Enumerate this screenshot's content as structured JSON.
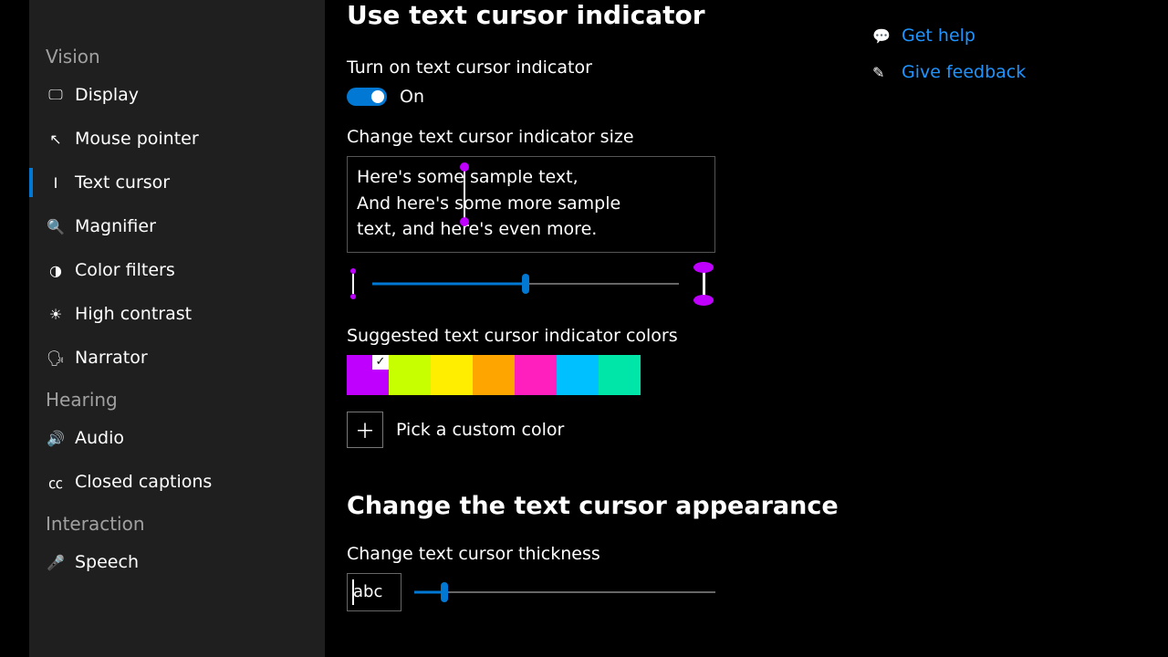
{
  "sidebar": {
    "sections": [
      {
        "title": "Vision",
        "items": [
          {
            "icon": "display-icon",
            "label": "Display"
          },
          {
            "icon": "pointer-icon",
            "label": "Mouse pointer"
          },
          {
            "icon": "textcursor-icon",
            "label": "Text cursor",
            "active": true
          },
          {
            "icon": "magnifier-icon",
            "label": "Magnifier"
          },
          {
            "icon": "filters-icon",
            "label": "Color filters"
          },
          {
            "icon": "contrast-icon",
            "label": "High contrast"
          },
          {
            "icon": "narrator-icon",
            "label": "Narrator"
          }
        ]
      },
      {
        "title": "Hearing",
        "items": [
          {
            "icon": "audio-icon",
            "label": "Audio"
          },
          {
            "icon": "cc-icon",
            "label": "Closed captions"
          }
        ]
      },
      {
        "title": "Interaction",
        "items": [
          {
            "icon": "speech-icon",
            "label": "Speech"
          }
        ]
      }
    ]
  },
  "main": {
    "title": "Use text cursor indicator",
    "toggle_label": "Turn on text cursor indicator",
    "toggle_state": "On",
    "size_label": "Change text cursor indicator size",
    "sample_line1": "Here's some sample text,",
    "sample_line2": "And here's some more sample",
    "sample_line3": "text, and here's even more.",
    "size_slider_pct": 50,
    "colors_label": "Suggested text cursor indicator colors",
    "swatches": [
      "#c000ff",
      "#c8ff00",
      "#ffee00",
      "#ffa500",
      "#ff1fbf",
      "#00c0ff",
      "#00e6a8"
    ],
    "selected_swatch_index": 0,
    "custom_label": "Pick a custom color",
    "appearance_header": "Change the text cursor appearance",
    "thickness_label": "Change text cursor thickness",
    "thickness_sample": "abc",
    "thickness_slider_pct": 10
  },
  "rail": {
    "help": "Get help",
    "feedback": "Give feedback"
  }
}
